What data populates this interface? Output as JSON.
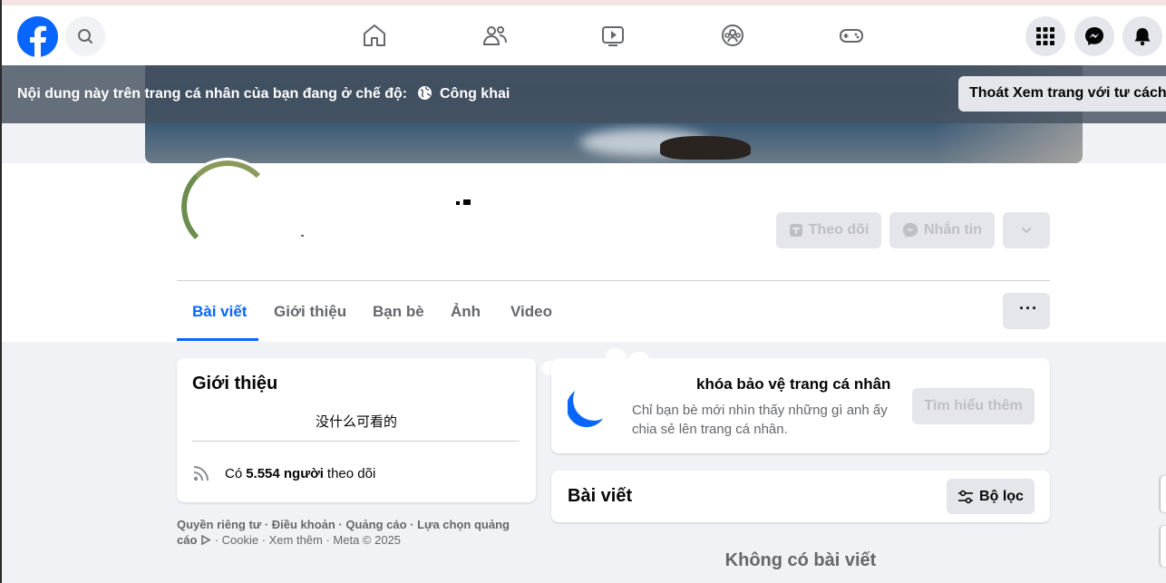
{
  "banner": {
    "text": "Nội dung này trên trang cá nhân của bạn đang ở chế độ:",
    "audience": "Công khai",
    "exit_button": "Thoát Xem trang với tư cách"
  },
  "profile_actions": {
    "follow_label": "Theo dõi",
    "message_label": "Nhắn tin"
  },
  "tabs": [
    {
      "label": "Bài viết",
      "active": true
    },
    {
      "label": "Giới thiệu",
      "active": false
    },
    {
      "label": "Bạn bè",
      "active": false
    },
    {
      "label": "Ảnh",
      "active": false
    },
    {
      "label": "Video",
      "active": false
    }
  ],
  "more_button": "···",
  "intro": {
    "title": "Giới thiệu",
    "empty_text": "没什么可看的",
    "followers_prefix": "Có",
    "followers_count": "5.554 người",
    "followers_suffix": "theo dõi"
  },
  "footer": {
    "line1": "Quyền riêng tư · Điều khoản · Quảng cáo · Lựa chọn quảng",
    "line2_a": "cáo",
    "line2_b": "· Cookie · Xem thêm · Meta © 2025"
  },
  "lock_card": {
    "title": "khóa bảo vệ trang cá nhân",
    "description": "Chỉ bạn bè mới nhìn thấy những gì anh ấy chia sẻ lên trang cá nhân.",
    "learn_more": "Tìm hiểu thêm"
  },
  "posts": {
    "title": "Bài viết",
    "filter_label": "Bộ lọc",
    "empty_text": "Không có bài viết"
  },
  "colors": {
    "brand": "#0866ff",
    "banner_bg": "#465260",
    "page_bg": "#f0f2f5"
  },
  "icons": [
    "facebook-logo-icon",
    "search-icon",
    "home-icon",
    "friends-icon",
    "watch-icon",
    "groups-icon",
    "gaming-icon",
    "menu-grid-icon",
    "messenger-icon",
    "bell-icon",
    "globe-icon",
    "follow-icon",
    "messenger-small-icon",
    "chevron-down-icon",
    "rss-icon",
    "lock-shield-icon",
    "filter-icon"
  ]
}
